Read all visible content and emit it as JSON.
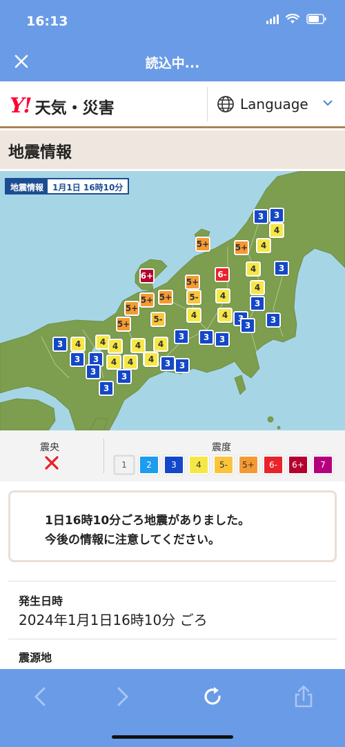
{
  "status_bar": {
    "time": "16:13"
  },
  "nav": {
    "title": "読込中..."
  },
  "header": {
    "logo_mark": "Y!",
    "logo_text": "天気・災害",
    "language_label": "Language"
  },
  "section": {
    "title": "地震情報"
  },
  "map": {
    "tag_label": "地震情報",
    "tag_date": "1月1日 16時10分",
    "markers": [
      {
        "value": "3",
        "cls": "s3"
      },
      {
        "value": "3",
        "cls": "s3"
      },
      {
        "value": "4",
        "cls": "s4"
      },
      {
        "value": "5+",
        "cls": "s5p"
      },
      {
        "value": "5+",
        "cls": "s5p"
      },
      {
        "value": "4",
        "cls": "s4"
      },
      {
        "value": "6+",
        "cls": "s6p"
      },
      {
        "value": "6-",
        "cls": "s6m"
      },
      {
        "value": "4",
        "cls": "s4"
      },
      {
        "value": "3",
        "cls": "s3"
      },
      {
        "value": "5+",
        "cls": "s5p"
      },
      {
        "value": "4",
        "cls": "s4"
      },
      {
        "value": "5+",
        "cls": "s5p"
      },
      {
        "value": "5+",
        "cls": "s5p"
      },
      {
        "value": "5-",
        "cls": "s5m"
      },
      {
        "value": "4",
        "cls": "s4"
      },
      {
        "value": "3",
        "cls": "s3"
      },
      {
        "value": "5+",
        "cls": "s5p"
      },
      {
        "value": "5-",
        "cls": "s5m"
      },
      {
        "value": "4",
        "cls": "s4"
      },
      {
        "value": "4",
        "cls": "s4"
      },
      {
        "value": "3",
        "cls": "s3"
      },
      {
        "value": "3",
        "cls": "s3"
      },
      {
        "value": "3",
        "cls": "s3"
      },
      {
        "value": "5+",
        "cls": "s5p"
      },
      {
        "value": "3",
        "cls": "s3"
      },
      {
        "value": "4",
        "cls": "s4"
      },
      {
        "value": "4",
        "cls": "s4"
      },
      {
        "value": "3",
        "cls": "s3"
      },
      {
        "value": "3",
        "cls": "s3"
      },
      {
        "value": "3",
        "cls": "s3"
      },
      {
        "value": "4",
        "cls": "s4"
      },
      {
        "value": "4",
        "cls": "s4"
      },
      {
        "value": "4",
        "cls": "s4"
      },
      {
        "value": "3",
        "cls": "s3"
      },
      {
        "value": "4",
        "cls": "s4"
      },
      {
        "value": "3",
        "cls": "s3"
      },
      {
        "value": "4",
        "cls": "s4"
      },
      {
        "value": "4",
        "cls": "s4"
      },
      {
        "value": "3",
        "cls": "s3"
      },
      {
        "value": "3",
        "cls": "s3"
      },
      {
        "value": "3",
        "cls": "s3"
      },
      {
        "value": "3",
        "cls": "s3"
      },
      {
        "value": "4",
        "cls": "s4"
      },
      {
        "value": "3",
        "cls": "s3"
      }
    ]
  },
  "legend": {
    "epicenter_title": "震央",
    "intensity_title": "震度",
    "levels": [
      {
        "label": "1",
        "color": "#f2f2f2",
        "text_color": "#555555"
      },
      {
        "label": "2",
        "color": "#1d9cf0",
        "text_color": "#ffffff"
      },
      {
        "label": "3",
        "color": "#1448c8",
        "text_color": "#ffffff"
      },
      {
        "label": "4",
        "color": "#f7e746",
        "text_color": "#333333"
      },
      {
        "label": "5-",
        "color": "#fbc43b",
        "text_color": "#333333"
      },
      {
        "label": "5+",
        "color": "#f59a33",
        "text_color": "#333333"
      },
      {
        "label": "6-",
        "color": "#e8242a",
        "text_color": "#ffffff"
      },
      {
        "label": "6+",
        "color": "#b3002f",
        "text_color": "#ffffff"
      },
      {
        "label": "7",
        "color": "#b5007e",
        "text_color": "#ffffff"
      }
    ]
  },
  "notice": {
    "line1": "1日16時10分ごろ地震がありました。",
    "line2": "今後の情報に注意してください。"
  },
  "details": {
    "occurred_label": "発生日時",
    "occurred_value": "2024年1月1日16時10分 ごろ",
    "epicenter_label": "震源地"
  }
}
